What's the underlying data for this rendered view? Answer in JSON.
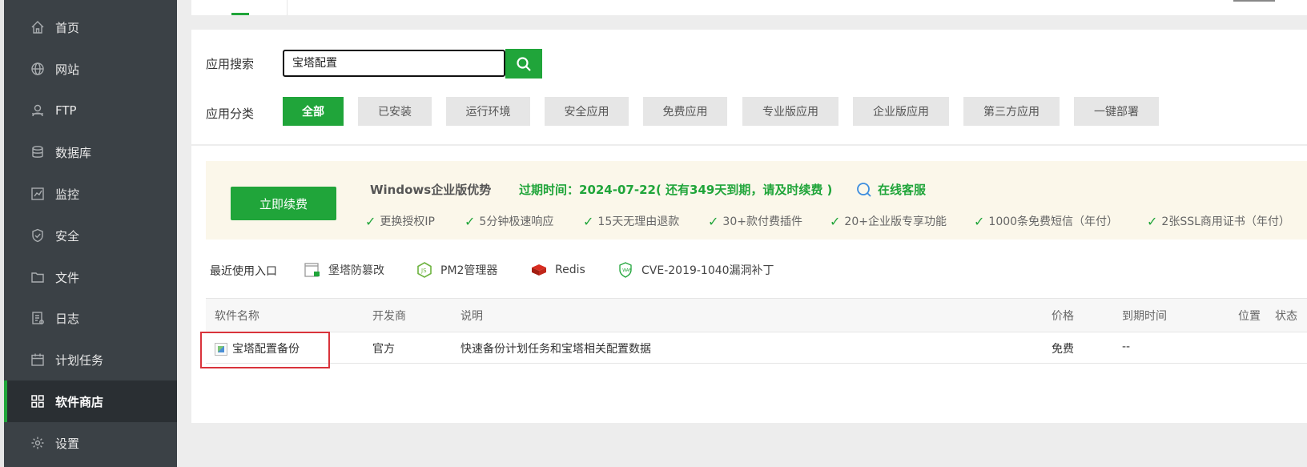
{
  "sidebar": {
    "items": [
      {
        "label": "首页",
        "icon": "home-icon"
      },
      {
        "label": "网站",
        "icon": "globe-icon"
      },
      {
        "label": "FTP",
        "icon": "ftp-icon"
      },
      {
        "label": "数据库",
        "icon": "database-icon"
      },
      {
        "label": "监控",
        "icon": "monitor-icon"
      },
      {
        "label": "安全",
        "icon": "shield-icon"
      },
      {
        "label": "文件",
        "icon": "folder-icon"
      },
      {
        "label": "日志",
        "icon": "log-icon"
      },
      {
        "label": "计划任务",
        "icon": "calendar-icon"
      },
      {
        "label": "软件商店",
        "icon": "grid-icon",
        "active": true
      },
      {
        "label": "设置",
        "icon": "gear-icon"
      }
    ]
  },
  "search": {
    "label": "应用搜索",
    "value": "宝塔配置"
  },
  "categories": {
    "label": "应用分类",
    "items": [
      "全部",
      "已安装",
      "运行环境",
      "安全应用",
      "免费应用",
      "专业版应用",
      "企业版应用",
      "第三方应用",
      "一键部署"
    ],
    "active_index": 0
  },
  "promo": {
    "renew_label": "立即续费",
    "title": "Windows企业版优势",
    "expire": "过期时间：2024-07-22( 还有349天到期，请及时续费 )",
    "support": "在线客服",
    "features": [
      "更换授权IP",
      "5分钟极速响应",
      "15天无理由退款",
      "30+款付费插件",
      "20+企业版专享功能",
      "1000条免费短信（年付）",
      "2张SSL商用证书（年付）"
    ]
  },
  "recent": {
    "label": "最近使用入口",
    "items": [
      {
        "label": "堡塔防篡改",
        "icon": "tamper-proof-icon"
      },
      {
        "label": "PM2管理器",
        "icon": "nodejs-icon"
      },
      {
        "label": "Redis",
        "icon": "redis-icon"
      },
      {
        "label": "CVE-2019-1040漏洞补丁",
        "icon": "patch-shield-icon"
      }
    ]
  },
  "table": {
    "headers": [
      "软件名称",
      "开发商",
      "说明",
      "价格",
      "到期时间",
      "位置",
      "状态"
    ],
    "rows": [
      {
        "name": "宝塔配置备份",
        "developer": "官方",
        "description": "快速备份计划任务和宝塔相关配置数据",
        "price": "免费",
        "expire": "--"
      }
    ]
  },
  "colors": {
    "brand": "#20a53a",
    "sidebar_bg": "#3b4146",
    "highlight": "#d9333b"
  }
}
